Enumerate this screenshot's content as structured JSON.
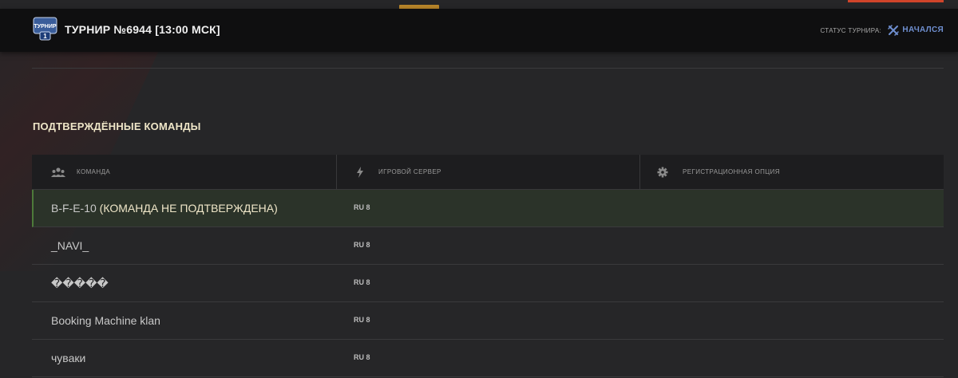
{
  "header": {
    "logo_text": "ТУРНИР",
    "logo_number": "1",
    "title": "ТУРНИР №6944 [13:00 МСК]",
    "status_label": "СТАТУС ТУРНИРА:",
    "status_value": "НАЧАЛСЯ",
    "status_color": "#6f8fd0"
  },
  "section": {
    "title": "ПОДТВЕРЖДЁННЫЕ КОМАНДЫ"
  },
  "table": {
    "columns": [
      {
        "label": "КОМАНДА",
        "icon": "team-icon"
      },
      {
        "label": "ИГРОВОЙ СЕРВЕР",
        "icon": "lightning-icon"
      },
      {
        "label": "РЕГИСТРАЦИОННАЯ ОПЦИЯ",
        "icon": "gear-icon"
      }
    ],
    "rows": [
      {
        "team": "B-F-E-10",
        "note": " (КОМАНДА НЕ ПОДТВЕРЖДЕНА)",
        "server": "RU 8",
        "option": ""
      },
      {
        "team": "_NAVI_",
        "server": "RU 8",
        "option": ""
      },
      {
        "team": "�����",
        "server": "RU 8",
        "option": ""
      },
      {
        "team": "Booking Machine klan",
        "server": "RU 8",
        "option": ""
      },
      {
        "team": "чуваки",
        "server": "RU 8",
        "option": ""
      }
    ]
  },
  "colors": {
    "accent_gold": "#efe6c8",
    "highlight_row": "#2b3329",
    "highlight_border": "#4d7a3a"
  }
}
